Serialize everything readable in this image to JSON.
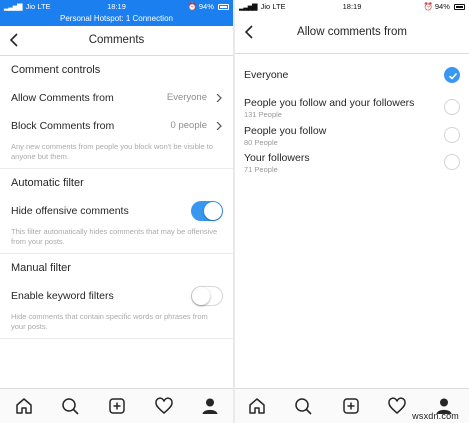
{
  "left": {
    "status": {
      "carrier": "Jio",
      "network": "LTE",
      "time": "18:19",
      "battery": "94%"
    },
    "hotspot_text": "Personal Hotspot: 1 Connection",
    "title": "Comments",
    "sections": {
      "comment_controls": "Comment controls",
      "automatic_filter": "Automatic filter",
      "manual_filter": "Manual filter"
    },
    "rows": {
      "allow_comments": {
        "label": "Allow Comments from",
        "value": "Everyone"
      },
      "block_comments": {
        "label": "Block Comments from",
        "value": "0 people"
      },
      "block_help": "Any new comments from people you block won't be visible to anyone but them.",
      "hide_offensive": {
        "label": "Hide offensive comments",
        "state": "on"
      },
      "hide_help": "This filter automatically hides comments that may be offensive from your posts.",
      "keyword_filters": {
        "label": "Enable keyword filters",
        "state": "off"
      },
      "keyword_help": "Hide comments that contain specific words or phrases from your posts."
    }
  },
  "right": {
    "status": {
      "carrier": "Jio",
      "network": "LTE",
      "time": "18:19",
      "battery": "94%"
    },
    "title": "Allow comments from",
    "options": [
      {
        "label": "Everyone",
        "sub": "",
        "selected": true
      },
      {
        "label": "People you follow and your followers",
        "sub": "131 People",
        "selected": false
      },
      {
        "label": "People you follow",
        "sub": "80 People",
        "selected": false
      },
      {
        "label": "Your followers",
        "sub": "71 People",
        "selected": false
      }
    ]
  },
  "tabbar_icons": [
    "home-icon",
    "search-icon",
    "add-post-icon",
    "activity-heart-icon",
    "profile-icon"
  ],
  "accent_color": "#3897f0",
  "status_bar_color": "#1c7ff0",
  "watermark": "wsxdn.com"
}
